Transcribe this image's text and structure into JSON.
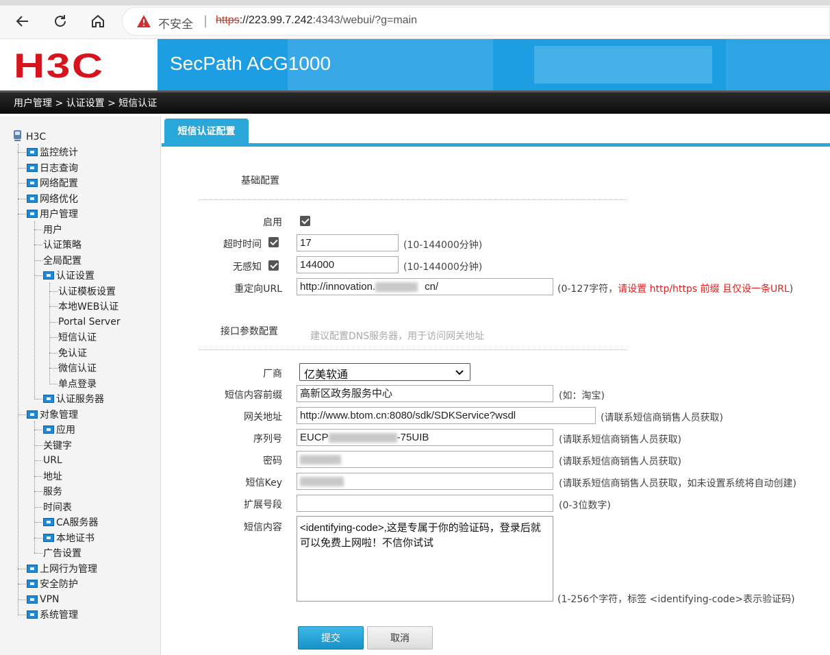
{
  "browser": {
    "not_secure": "不安全",
    "url_scheme": "https",
    "url_host": "://223.99.7.242",
    "url_rest": ":4343/webui/?g=main"
  },
  "header": {
    "logo": "H3C",
    "product": "SecPath ACG1000",
    "breadcrumb": "用户管理 > 认证设置 > 短信认证"
  },
  "sidebar": {
    "root": "H3C",
    "items": [
      "监控统计",
      "日志查询",
      "网络配置",
      "网络优化",
      "用户管理",
      "用户",
      "认证策略",
      "全局配置",
      "认证设置",
      "认证模板设置",
      "本地WEB认证",
      "Portal Server",
      "短信认证",
      "免认证",
      "微信认证",
      "单点登录",
      "认证服务器",
      "对象管理",
      "应用",
      "关键字",
      "URL",
      "地址",
      "服务",
      "时间表",
      "CA服务器",
      "本地证书",
      "广告设置",
      "上网行为管理",
      "安全防护",
      "VPN",
      "系统管理"
    ]
  },
  "content": {
    "tab": "短信认证配置",
    "basic_section": "基础配置",
    "enable_label": "启用",
    "timeout_label": "超时时间",
    "timeout_value": "17",
    "timeout_hint": "(10-144000分钟)",
    "seamless_label": "无感知",
    "seamless_value": "144000",
    "seamless_hint": "(10-144000分钟)",
    "redirect_label": "重定向URL",
    "redirect_value_a": "http://innovation.",
    "redirect_value_b": "cn/",
    "redirect_hint_a": "(0-127字符，",
    "redirect_hint_b": "请设置 http/https 前缀 且仅设一条URL",
    "redirect_hint_c": ")",
    "iface_section": "接口参数配置",
    "iface_note": "建议配置DNS服务器，用于访问网关地址",
    "vendor_label": "厂商",
    "vendor_value": "亿美软通",
    "prefix_label": "短信内容前缀",
    "prefix_value": "高新区政务服务中心",
    "prefix_hint": "(如：淘宝)",
    "gateway_label": "网关地址",
    "gateway_value": "http://www.btom.cn:8080/sdk/SDKService?wsdl",
    "gateway_hint": "(请联系短信商销售人员获取)",
    "serial_label": "序列号",
    "serial_value_a": "EUCP",
    "serial_value_b": "-75UIB",
    "serial_hint": "(请联系短信商销售人员获取)",
    "password_label": "密码",
    "password_hint": "(请联系短信商销售人员获取)",
    "smskey_label": "短信Key",
    "smskey_hint": "(请联系短信商销售人员获取，如未设置系统将自动创建)",
    "ext_label": "扩展号段",
    "ext_value": "",
    "ext_hint": "(0-3位数字)",
    "sms_content_label": "短信内容",
    "sms_content_value": "<identifying-code>,这是专属于你的验证码，登录后就可以免费上网啦！不信你试试",
    "sms_content_hint": "(1-256个字符，标签 <identifying-code>表示验证码)",
    "submit": "提交",
    "cancel": "取消"
  },
  "colors": {
    "accent": "#2aa7d9",
    "brand_red": "#d6141e",
    "warning_red": "#e02020"
  }
}
